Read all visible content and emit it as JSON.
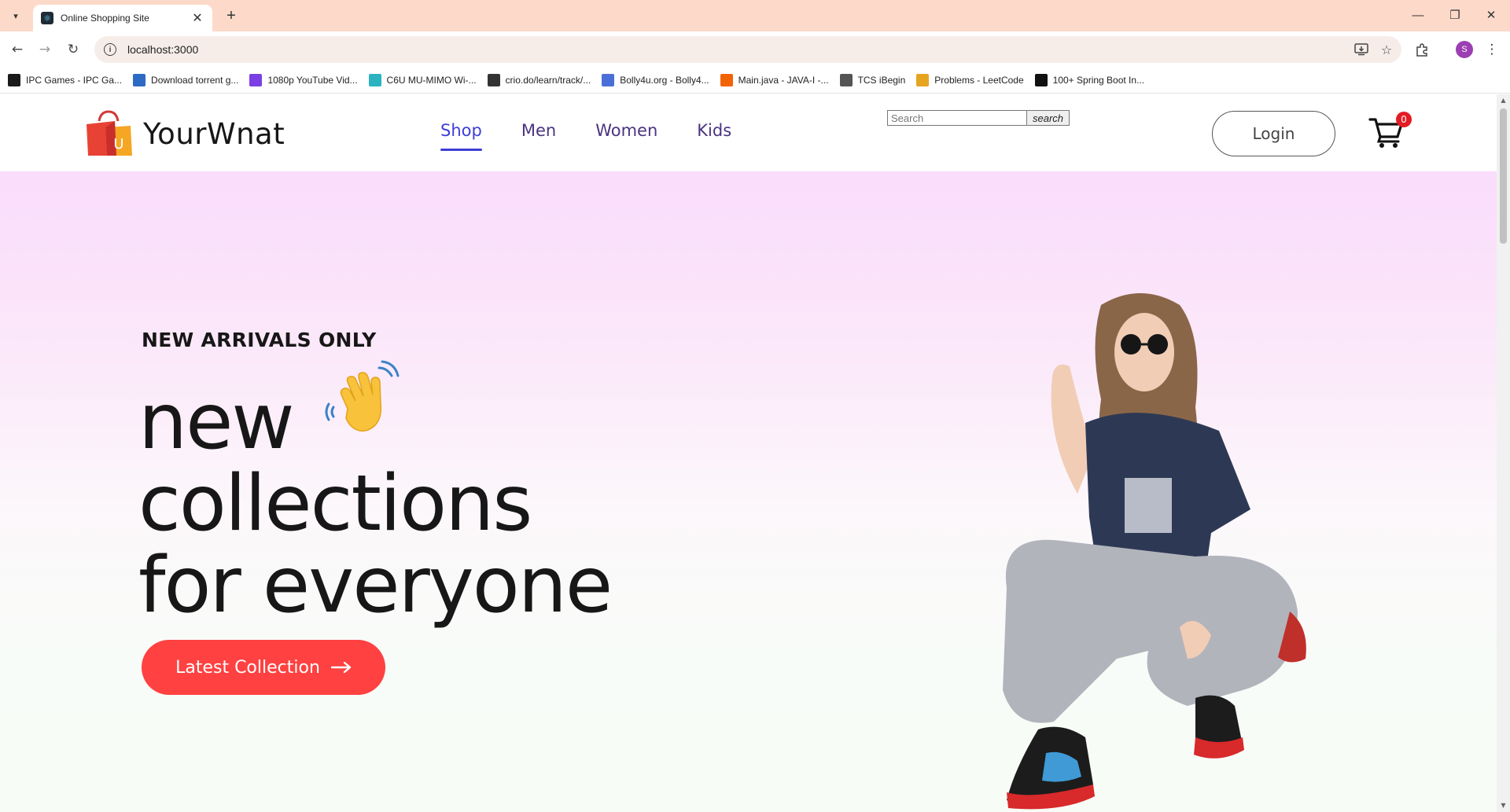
{
  "browser": {
    "tab": {
      "title": "Online Shopping Site"
    },
    "address": {
      "url": "localhost:3000"
    },
    "profile_initial": "S",
    "bookmarks": [
      {
        "label": "IPC Games - IPC Ga...",
        "icon": "ipc-icon",
        "color": "#1a1a1a"
      },
      {
        "label": "Download torrent g...",
        "icon": "torrent-icon",
        "color": "#2d6ac4"
      },
      {
        "label": "1080p YouTube Vid...",
        "icon": "v-icon",
        "color": "#7b3fe4"
      },
      {
        "label": "C6U MU-MIMO Wi-...",
        "icon": "tplink-icon",
        "color": "#2bb3c0"
      },
      {
        "label": "crio.do/learn/track/...",
        "icon": "crio-icon",
        "color": "#333333"
      },
      {
        "label": "Bolly4u.org - Bolly4...",
        "icon": "bolly-icon",
        "color": "#4a6fd8"
      },
      {
        "label": "Main.java - JAVA-I -...",
        "icon": "replit-icon",
        "color": "#f26207"
      },
      {
        "label": "TCS iBegin",
        "icon": "tcs-icon",
        "color": "#555555"
      },
      {
        "label": "Problems - LeetCode",
        "icon": "leetcode-icon",
        "color": "#e7a41f"
      },
      {
        "label": "100+ Spring Boot In...",
        "icon": "book-icon",
        "color": "#111111"
      }
    ]
  },
  "site": {
    "brand": {
      "name": "YourWnat",
      "badge_letter": "U"
    },
    "menu": [
      {
        "label": "Shop",
        "active": true
      },
      {
        "label": "Men",
        "active": false
      },
      {
        "label": "Women",
        "active": false
      },
      {
        "label": "Kids",
        "active": false
      }
    ],
    "search": {
      "placeholder": "Search",
      "button_label": "search"
    },
    "login_label": "Login",
    "cart_count": "0"
  },
  "hero": {
    "eyebrow": "NEW ARRIVALS ONLY",
    "line1": "new",
    "line2": "collections",
    "line3": "for everyone",
    "cta_label": "Latest Collection",
    "accent_color": "#ff4141"
  }
}
